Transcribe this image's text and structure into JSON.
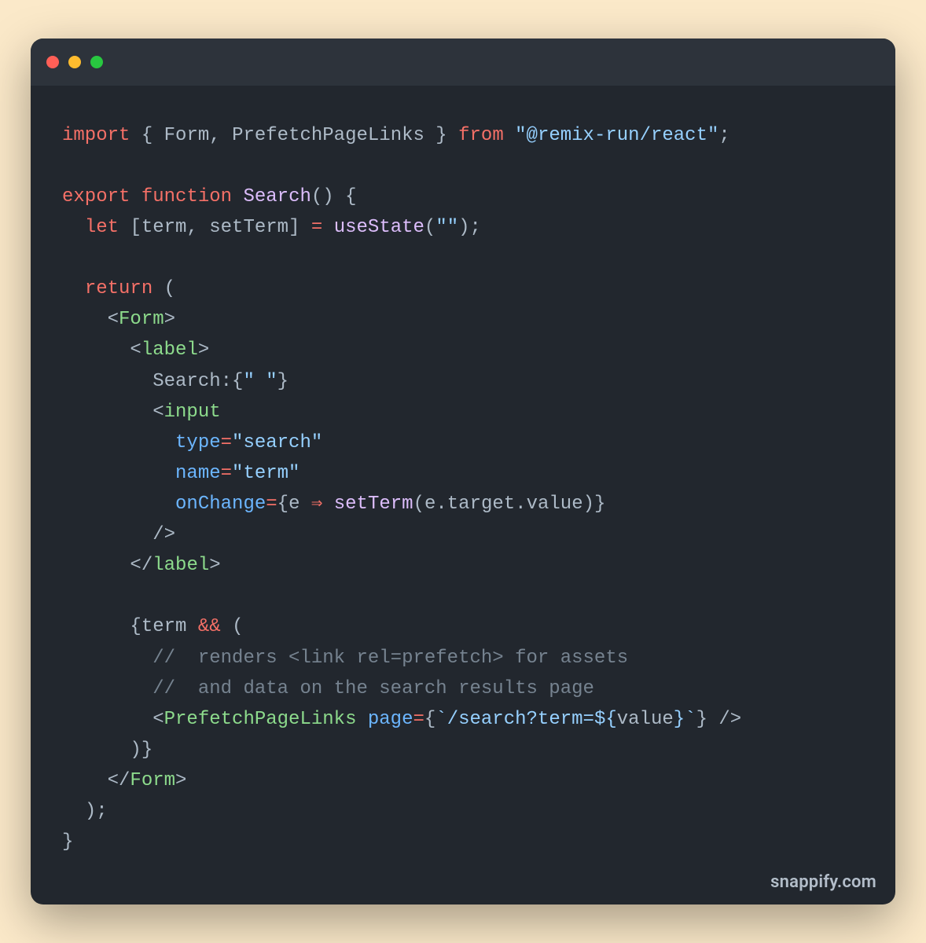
{
  "titlebar": {
    "dot_colors": [
      "#ff5f57",
      "#febc2e",
      "#28c840"
    ]
  },
  "watermark": "snappify.com",
  "code": {
    "line1": {
      "kw1": "import",
      "braceL": " { ",
      "id1": "Form",
      "comma": ", ",
      "id2": "PrefetchPageLinks",
      "braceR": " } ",
      "kw2": "from",
      "sp": " ",
      "str": "\"@remix-run/react\"",
      "semi": ";"
    },
    "line2": "",
    "line3": {
      "kw1": "export",
      "sp1": " ",
      "kw2": "function",
      "sp2": " ",
      "fn": "Search",
      "parens": "() {"
    },
    "line4": {
      "indent": "  ",
      "kw": "let",
      "sp": " ",
      "dest": "[term, setTerm]",
      "eq": " = ",
      "fn": "useState",
      "call": "(",
      "str": "\"\"",
      "callEnd": ");"
    },
    "line5": "",
    "line6": {
      "indent": "  ",
      "kw": "return",
      "sp": " ",
      "paren": "("
    },
    "line7": {
      "indent": "    ",
      "open": "<",
      "tag": "Form",
      "close": ">"
    },
    "line8": {
      "indent": "      ",
      "open": "<",
      "tag": "label",
      "close": ">"
    },
    "line9": {
      "indent": "        ",
      "text": "Search:",
      "brace": "{",
      "str": "\" \"",
      "braceR": "}"
    },
    "line10": {
      "indent": "        ",
      "open": "<",
      "tag": "input"
    },
    "line11": {
      "indent": "          ",
      "attr": "type",
      "eq": "=",
      "str": "\"search\""
    },
    "line12": {
      "indent": "          ",
      "attr": "name",
      "eq": "=",
      "str": "\"term\""
    },
    "line13": {
      "indent": "          ",
      "attr": "onChange",
      "eq": "=",
      "braceL": "{",
      "param": "e",
      "arrow": " ⇒ ",
      "fn": "setTerm",
      "call": "(e.target.value)}"
    },
    "line14": {
      "indent": "        ",
      "selfclose": "/>"
    },
    "line15": {
      "indent": "      ",
      "open": "</",
      "tag": "label",
      "close": ">"
    },
    "line16": "",
    "line17": {
      "indent": "      ",
      "braceL": "{",
      "id": "term",
      "sp": " ",
      "amp": "&&",
      "sp2": " ",
      "paren": "("
    },
    "line18": {
      "indent": "        ",
      "cmt": "//  renders <link rel=prefetch> for assets"
    },
    "line19": {
      "indent": "        ",
      "cmt": "//  and data on the search results page"
    },
    "line20": {
      "indent": "        ",
      "open": "<",
      "tag": "PrefetchPageLinks",
      "sp": " ",
      "attr": "page",
      "eq": "=",
      "braceL": "{",
      "tick": "`/search?term=",
      "dollL": "${",
      "id": "value",
      "dollR": "}",
      "tick2": "`",
      "braceR": "}",
      "sp2": " ",
      "selfclose": "/>"
    },
    "line21": {
      "indent": "      ",
      "text": ")}"
    },
    "line22": {
      "indent": "    ",
      "open": "</",
      "tag": "Form",
      "close": ">"
    },
    "line23": {
      "indent": "  ",
      "text": ");"
    },
    "line24": {
      "text": "}"
    }
  }
}
